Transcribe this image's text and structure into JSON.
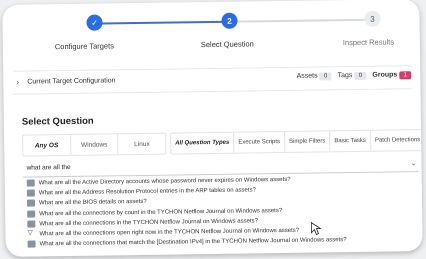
{
  "stepper": {
    "steps": [
      {
        "label": "Configure Targets",
        "mark": "✓"
      },
      {
        "label": "Select Question",
        "mark": "2"
      },
      {
        "label": "Inspect Results",
        "mark": "3"
      }
    ]
  },
  "target": {
    "label": "Current Target Configuration",
    "assets_label": "Assets",
    "assets_count": "0",
    "tags_label": "Tags",
    "tags_count": "0",
    "groups_label": "Groups",
    "groups_count": "1"
  },
  "select_question": {
    "title": "Select Question",
    "os_tabs": [
      "Any OS",
      "Windows",
      "Linux"
    ],
    "type_tabs": [
      "All Question Types",
      "Execute Scripts",
      "Simple Filters",
      "Basic Tasks",
      "Patch Detections"
    ]
  },
  "search": {
    "value": "what are all the"
  },
  "results": [
    {
      "text": "What are all the Active Directory accounts whose password never expires on Windows assets?",
      "icon": "table-icon"
    },
    {
      "text": "What are all the Address Resolution Protocol entries in the ARP tables on assets?",
      "icon": "table-icon"
    },
    {
      "text": "What are all the BIOS details on assets?",
      "icon": "table-icon"
    },
    {
      "text": "What are all the connections by count in the TYCHON Netflow Journal on Windows assets?",
      "icon": "table-icon"
    },
    {
      "text": "What are all the connections in the TYCHON Netflow Journal on Windows assets?",
      "icon": "table-icon"
    },
    {
      "text": "What are all the connections open right now in the TYCHON Netflow Journal on Windows assets?",
      "icon": "filter-icon"
    },
    {
      "text": "What are all the connections that match the [Destination IPv4] in the TYCHON Netflow Journal on Windows assets?",
      "icon": "table-icon"
    }
  ],
  "colors": {
    "accent": "#2d6cdf",
    "groups_badge": "#d63b6e"
  }
}
